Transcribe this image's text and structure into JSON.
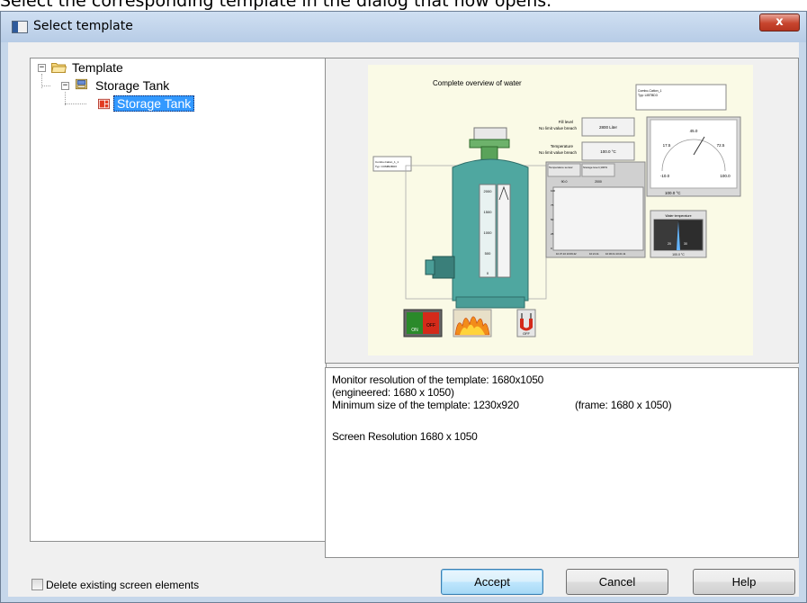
{
  "instruction": "Select the corresponding template in the dialog that now opens.",
  "dialog": {
    "title": "Select template",
    "close_label": "x"
  },
  "tree": {
    "root": {
      "label": "Template",
      "expander": "−"
    },
    "child": {
      "label": "Storage Tank",
      "expander": "−"
    },
    "leaf": {
      "label": "Storage Tank"
    }
  },
  "preview": {
    "title": "Complete overview of water",
    "fill_level_label": "Fill level",
    "fill_level_limit": "No limit value breach",
    "fill_level_value": "2800 Liter",
    "temperature_label": "Temperature",
    "temperature_limit": "No limit value breach",
    "temperature_value": "100.0 °C",
    "combo_top_right": "Combo-Cation_1",
    "combo_top_right_type": "Typ: LIBTBD3",
    "combo_left": "Combo-Cation_1_1",
    "combo_left_type": "Typ: COMBOBOX",
    "gauge_ticks": [
      "45.0",
      "17.5",
      "72.5",
      "-10.0",
      "100.0"
    ],
    "gauge_value": "100.0 °C",
    "trend_headers": [
      "Temperature sensor",
      "Storage level (100%"
    ],
    "trend_values": [
      "90.0",
      "2000"
    ],
    "trend_yticks": [
      "100",
      "75",
      "50",
      "25",
      "0"
    ],
    "trend_times": [
      "10.07.10 10:09:42",
      "10:21:11",
      "10:30:41 10:21:11"
    ],
    "tank_scale": [
      "2000",
      "1500",
      "1000",
      "500",
      "0"
    ],
    "water_temperature_title": "Water temperature",
    "water_temperature_ticks": [
      "20",
      "30"
    ],
    "water_temperature_value": "100.0 °C",
    "on_label": "ON",
    "off_label": "OFF",
    "plug_label": "OFF"
  },
  "info": {
    "line1": "Monitor resolution of the template: 1680x1050",
    "line2": "(engineered: 1680 x 1050)",
    "line3": "Minimum size of the template: 1230x920",
    "line3_frame": "(frame: 1680 x 1050)",
    "line4": "Screen Resolution 1680 x 1050"
  },
  "footer": {
    "checkbox_label": "Delete existing screen elements",
    "accept_label": "Accept",
    "cancel_label": "Cancel",
    "help_label": "Help"
  },
  "colors": {
    "dialog_frame": "#c6d7ea",
    "selection": "#3399ff",
    "preview_background": "#fafae6",
    "tank": "#4fa7a0"
  }
}
